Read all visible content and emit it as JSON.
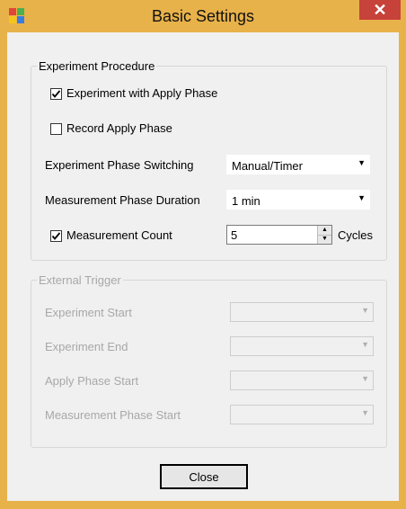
{
  "window": {
    "title": "Basic Settings",
    "close_glyph": "✕",
    "icon": "app-icon"
  },
  "experiment_procedure": {
    "legend": "Experiment Procedure",
    "experiment_with_apply_phase": {
      "label": "Experiment with Apply Phase",
      "checked": true
    },
    "record_apply_phase": {
      "label": "Record Apply Phase",
      "checked": false
    },
    "phase_switching": {
      "label": "Experiment Phase Switching",
      "value": "Manual/Timer"
    },
    "measurement_duration": {
      "label": "Measurement Phase Duration",
      "value": "1 min"
    },
    "measurement_count": {
      "label": "Measurement Count",
      "checked": true,
      "value": "5",
      "unit": "Cycles"
    }
  },
  "external_trigger": {
    "legend": "External Trigger",
    "rows": [
      {
        "label": "Experiment Start",
        "value": ""
      },
      {
        "label": "Experiment End",
        "value": ""
      },
      {
        "label": "Apply Phase Start",
        "value": ""
      },
      {
        "label": "Measurement Phase Start",
        "value": ""
      }
    ]
  },
  "buttons": {
    "close": "Close"
  },
  "colors": {
    "frame": "#e8b24a",
    "close_button": "#c7423a",
    "client": "#f0f0f0",
    "disabled_text": "#a8a8a8"
  }
}
